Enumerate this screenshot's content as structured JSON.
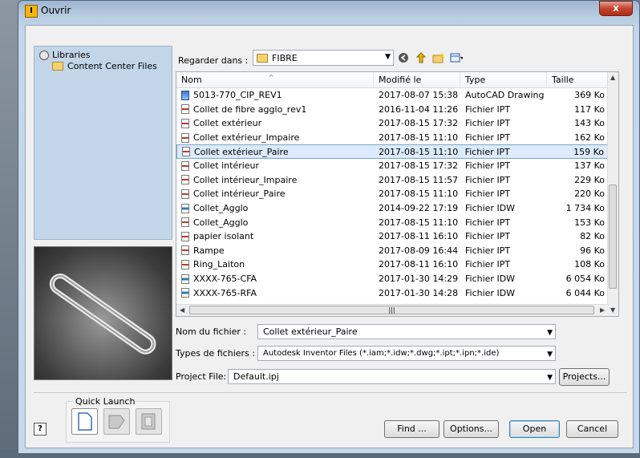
{
  "window": {
    "title": "Ouvrir",
    "close_label": "x"
  },
  "libraries": {
    "root": "Libraries",
    "child": "Content Center Files"
  },
  "lookin": {
    "label": "Regarder dans :",
    "value": "FIBRE"
  },
  "list": {
    "headers": {
      "name": "Nom",
      "date": "Modifié le",
      "type": "Type",
      "size": "Taille"
    },
    "rows": [
      {
        "name": "5013-770_CIP_REV1",
        "date": "2017-08-07 15:38",
        "type": "AutoCAD Drawing",
        "size": "369 Ko",
        "icon": "dwg"
      },
      {
        "name": "Collet de fibre agglo_rev1",
        "date": "2016-11-04 11:26",
        "type": "Fichier IPT",
        "size": "117 Ko",
        "icon": "ipt"
      },
      {
        "name": "Collet extérieur",
        "date": "2017-08-15 17:32",
        "type": "Fichier IPT",
        "size": "143 Ko",
        "icon": "ipt"
      },
      {
        "name": "Collet extérieur_Impaire",
        "date": "2017-08-15 11:10",
        "type": "Fichier IPT",
        "size": "162 Ko",
        "icon": "ipt"
      },
      {
        "name": "Collet extérieur_Paire",
        "date": "2017-08-15 11:10",
        "type": "Fichier IPT",
        "size": "159 Ko",
        "icon": "ipt",
        "selected": true
      },
      {
        "name": "Collet intérieur",
        "date": "2017-08-15 17:32",
        "type": "Fichier IPT",
        "size": "137 Ko",
        "icon": "ipt"
      },
      {
        "name": "Collet intérieur_Impaire",
        "date": "2017-08-15 11:57",
        "type": "Fichier IPT",
        "size": "229 Ko",
        "icon": "ipt"
      },
      {
        "name": "Collet intérieur_Paire",
        "date": "2017-08-15 11:10",
        "type": "Fichier IPT",
        "size": "220 Ko",
        "icon": "ipt"
      },
      {
        "name": "Collet_Agglo",
        "date": "2014-09-22 17:19",
        "type": "Fichier IDW",
        "size": "1 734 Ko",
        "icon": "idw"
      },
      {
        "name": "Collet_Agglo",
        "date": "2017-08-15 11:10",
        "type": "Fichier IPT",
        "size": "153 Ko",
        "icon": "ipt"
      },
      {
        "name": "papier isolant",
        "date": "2017-08-11 16:10",
        "type": "Fichier IPT",
        "size": "82 Ko",
        "icon": "ipt"
      },
      {
        "name": "Rampe",
        "date": "2017-08-09 16:44",
        "type": "Fichier IPT",
        "size": "96 Ko",
        "icon": "ipt"
      },
      {
        "name": "Ring_Laiton",
        "date": "2017-08-11 16:10",
        "type": "Fichier IPT",
        "size": "108 Ko",
        "icon": "ipt"
      },
      {
        "name": "XXXX-765-CFA",
        "date": "2017-01-30 14:29",
        "type": "Fichier IDW",
        "size": "6 054 Ko",
        "icon": "idw"
      },
      {
        "name": "XXXX-765-RFA",
        "date": "2017-01-30 14:28",
        "type": "Fichier IDW",
        "size": "6 044 Ko",
        "icon": "idw"
      }
    ]
  },
  "form": {
    "filename_label": "Nom du fichier :",
    "filename_value": "Collet extérieur_Paire",
    "filetypes_label": "Types de fichiers :",
    "filetypes_value": "Autodesk Inventor Files (*.iam;*.idw;*.dwg;*.ipt;*.ipn;*.ide)",
    "project_label": "Project File:",
    "project_value": "Default.ipj",
    "projects_button": "Projects..."
  },
  "quick_launch": {
    "label": "Quick Launch"
  },
  "buttons": {
    "help": "?",
    "find": "Find ...",
    "options": "Options...",
    "open": "Open",
    "cancel": "Cancel"
  }
}
